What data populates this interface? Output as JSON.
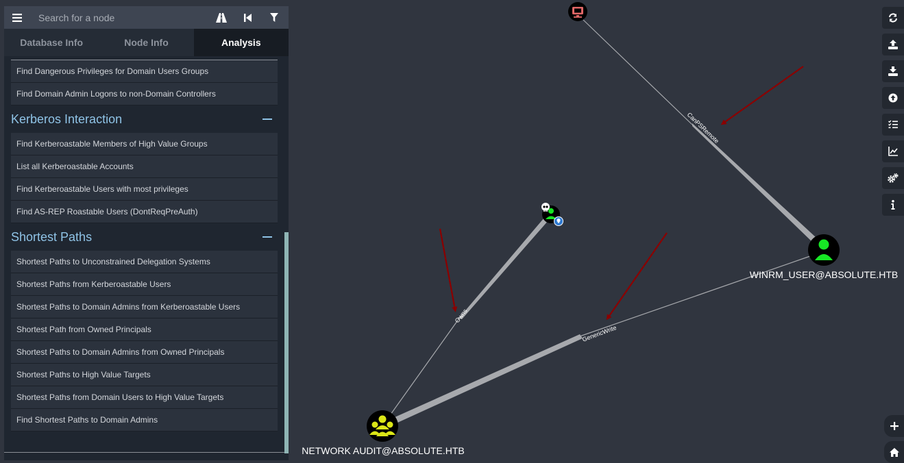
{
  "search": {
    "placeholder": "Search for a node"
  },
  "tabs": [
    {
      "label": "Database Info",
      "active": false
    },
    {
      "label": "Node Info",
      "active": false
    },
    {
      "label": "Analysis",
      "active": true
    }
  ],
  "top_queries": [
    {
      "label": "Find Dangerous Privileges for Domain Users Groups"
    },
    {
      "label": "Find Domain Admin Logons to non-Domain Controllers"
    }
  ],
  "sections": [
    {
      "title": "Kerberos Interaction",
      "queries": [
        {
          "label": "Find Kerberoastable Members of High Value Groups"
        },
        {
          "label": "List all Kerberoastable Accounts"
        },
        {
          "label": "Find Kerberoastable Users with most privileges"
        },
        {
          "label": "Find AS-REP Roastable Users (DontReqPreAuth)"
        }
      ]
    },
    {
      "title": "Shortest Paths",
      "queries": [
        {
          "label": "Shortest Paths to Unconstrained Delegation Systems"
        },
        {
          "label": "Shortest Paths from Kerberoastable Users"
        },
        {
          "label": "Shortest Paths to Domain Admins from Kerberoastable Users"
        },
        {
          "label": "Shortest Path from Owned Principals"
        },
        {
          "label": "Shortest Paths to Domain Admins from Owned Principals"
        },
        {
          "label": "Shortest Paths to High Value Targets"
        },
        {
          "label": "Shortest Paths from Domain Users to High Value Targets"
        },
        {
          "label": "Find Shortest Paths to Domain Admins"
        }
      ]
    }
  ],
  "graph": {
    "nodes": [
      {
        "id": "computer",
        "type": "computer",
        "label": "",
        "color": "#e06666"
      },
      {
        "id": "owned_user",
        "type": "user",
        "label": "",
        "owned": true,
        "color": "#17e625"
      },
      {
        "id": "winrm_user",
        "type": "user",
        "label": "WINRM_USER@ABSOLUTE.HTB",
        "color": "#17e625"
      },
      {
        "id": "network_audit",
        "type": "group",
        "label": "NETWORK AUDIT@ABSOLUTE.HTB",
        "color": "#dbe617"
      }
    ],
    "edges": [
      {
        "label": "CanPSRemote",
        "from": "winrm_user",
        "to": "computer"
      },
      {
        "label": "Owns",
        "from": "network_audit",
        "to": "owned_user"
      },
      {
        "label": "GenericWrite",
        "from": "network_audit",
        "to": "winrm_user"
      }
    ],
    "annotation_color": "#8b0000"
  },
  "toolbar": [
    {
      "name": "refresh-icon"
    },
    {
      "name": "upload-icon"
    },
    {
      "name": "download-icon"
    },
    {
      "name": "import-icon"
    },
    {
      "name": "queries-icon"
    },
    {
      "name": "chart-icon"
    },
    {
      "name": "settings-icon"
    },
    {
      "name": "info-icon"
    }
  ],
  "zoom": [
    {
      "name": "zoom-in-icon"
    },
    {
      "name": "home-icon"
    }
  ]
}
